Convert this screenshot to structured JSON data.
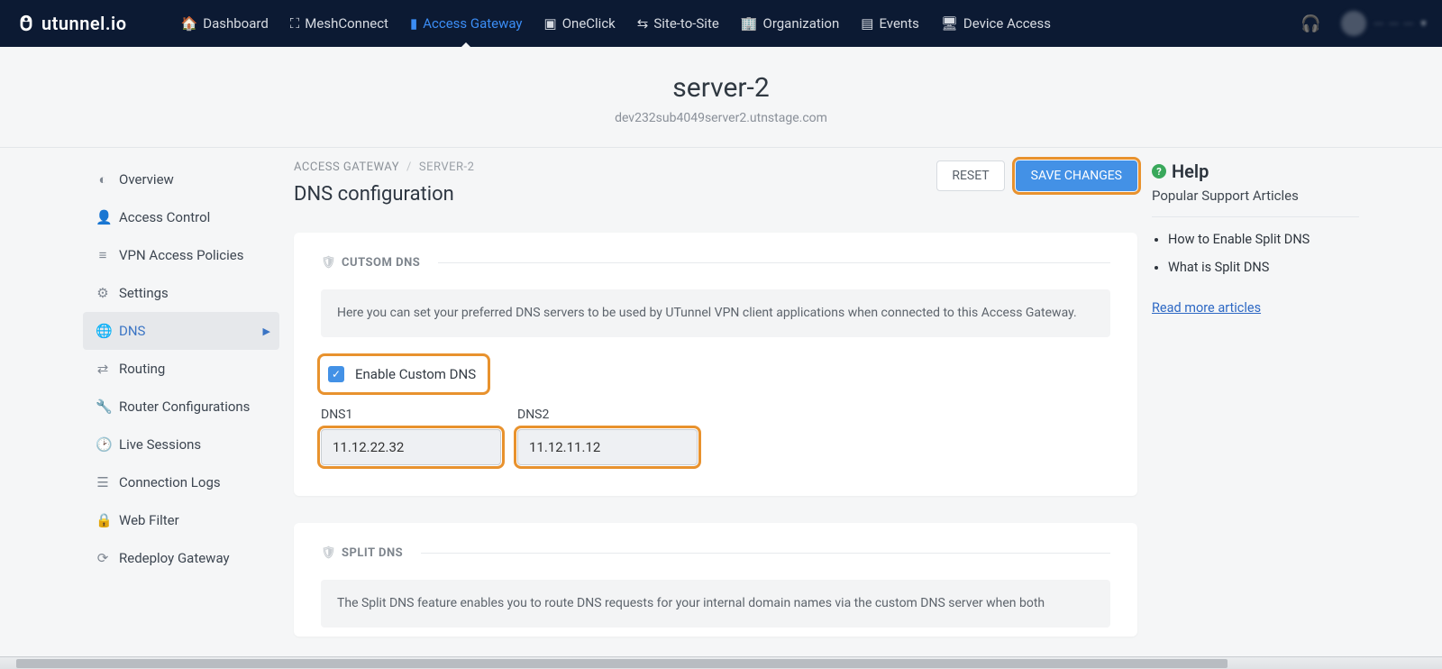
{
  "brand": "utunnel.io",
  "nav": {
    "items": [
      {
        "label": "Dashboard"
      },
      {
        "label": "MeshConnect"
      },
      {
        "label": "Access Gateway",
        "active": true
      },
      {
        "label": "OneClick"
      },
      {
        "label": "Site-to-Site"
      },
      {
        "label": "Organization"
      },
      {
        "label": "Events"
      },
      {
        "label": "Device Access"
      }
    ]
  },
  "header": {
    "title": "server-2",
    "subtitle": "dev232sub4049server2.utnstage.com"
  },
  "sidebar": {
    "items": [
      {
        "label": "Overview"
      },
      {
        "label": "Access Control"
      },
      {
        "label": "VPN Access Policies"
      },
      {
        "label": "Settings"
      },
      {
        "label": "DNS",
        "active": true
      },
      {
        "label": "Routing"
      },
      {
        "label": "Router Configurations"
      },
      {
        "label": "Live Sessions"
      },
      {
        "label": "Connection Logs"
      },
      {
        "label": "Web Filter"
      },
      {
        "label": "Redeploy Gateway"
      }
    ]
  },
  "breadcrumb": {
    "root": "ACCESS GATEWAY",
    "current": "SERVER-2"
  },
  "content": {
    "title": "DNS configuration",
    "reset": "RESET",
    "save": "SAVE CHANGES",
    "custom_dns": {
      "heading": "CUTSOM DNS",
      "info": "Here you can set your preferred DNS servers to be used by UTunnel VPN client applications when connected to this Access Gateway.",
      "checkbox_label": "Enable Custom DNS",
      "checked": true,
      "dns1_label": "DNS1",
      "dns1_value": "11.12.22.32",
      "dns2_label": "DNS2",
      "dns2_value": "11.12.11.12"
    },
    "split_dns": {
      "heading": "SPLIT DNS",
      "info": "The Split DNS feature enables you to route DNS requests for your internal domain names via the custom DNS server when both"
    }
  },
  "help": {
    "title": "Help",
    "subtitle": "Popular Support Articles",
    "articles": [
      "How to Enable Split DNS",
      "What is Split DNS"
    ],
    "more": "Read more articles"
  }
}
